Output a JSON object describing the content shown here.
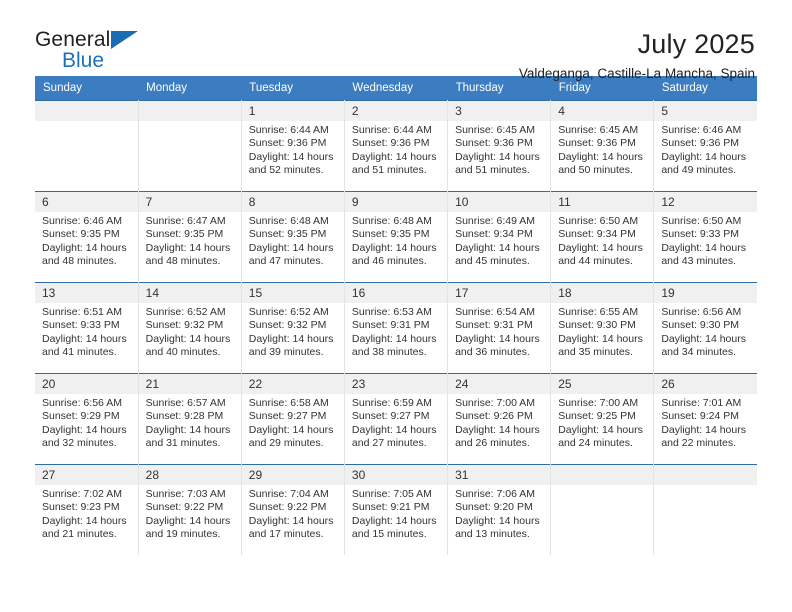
{
  "brand": {
    "line1": "General",
    "line2": "Blue",
    "triangle_color": "#1b6cb3"
  },
  "header": {
    "month_title": "July 2025",
    "location": "Valdeganga, Castille-La Mancha, Spain"
  },
  "colors": {
    "header_row_bg": "#3b7dc0",
    "week_separator": "#2e6ca8",
    "daynum_bg": "#f0f0f0",
    "accent_blue": "#1d72b8"
  },
  "weekday_headers": [
    "Sunday",
    "Monday",
    "Tuesday",
    "Wednesday",
    "Thursday",
    "Friday",
    "Saturday"
  ],
  "weeks": [
    [
      {
        "day": "",
        "lines": []
      },
      {
        "day": "",
        "lines": []
      },
      {
        "day": "1",
        "lines": [
          "Sunrise: 6:44 AM",
          "Sunset: 9:36 PM",
          "Daylight: 14 hours",
          "and 52 minutes."
        ]
      },
      {
        "day": "2",
        "lines": [
          "Sunrise: 6:44 AM",
          "Sunset: 9:36 PM",
          "Daylight: 14 hours",
          "and 51 minutes."
        ]
      },
      {
        "day": "3",
        "lines": [
          "Sunrise: 6:45 AM",
          "Sunset: 9:36 PM",
          "Daylight: 14 hours",
          "and 51 minutes."
        ]
      },
      {
        "day": "4",
        "lines": [
          "Sunrise: 6:45 AM",
          "Sunset: 9:36 PM",
          "Daylight: 14 hours",
          "and 50 minutes."
        ]
      },
      {
        "day": "5",
        "lines": [
          "Sunrise: 6:46 AM",
          "Sunset: 9:36 PM",
          "Daylight: 14 hours",
          "and 49 minutes."
        ]
      }
    ],
    [
      {
        "day": "6",
        "lines": [
          "Sunrise: 6:46 AM",
          "Sunset: 9:35 PM",
          "Daylight: 14 hours",
          "and 48 minutes."
        ]
      },
      {
        "day": "7",
        "lines": [
          "Sunrise: 6:47 AM",
          "Sunset: 9:35 PM",
          "Daylight: 14 hours",
          "and 48 minutes."
        ]
      },
      {
        "day": "8",
        "lines": [
          "Sunrise: 6:48 AM",
          "Sunset: 9:35 PM",
          "Daylight: 14 hours",
          "and 47 minutes."
        ]
      },
      {
        "day": "9",
        "lines": [
          "Sunrise: 6:48 AM",
          "Sunset: 9:35 PM",
          "Daylight: 14 hours",
          "and 46 minutes."
        ]
      },
      {
        "day": "10",
        "lines": [
          "Sunrise: 6:49 AM",
          "Sunset: 9:34 PM",
          "Daylight: 14 hours",
          "and 45 minutes."
        ]
      },
      {
        "day": "11",
        "lines": [
          "Sunrise: 6:50 AM",
          "Sunset: 9:34 PM",
          "Daylight: 14 hours",
          "and 44 minutes."
        ]
      },
      {
        "day": "12",
        "lines": [
          "Sunrise: 6:50 AM",
          "Sunset: 9:33 PM",
          "Daylight: 14 hours",
          "and 43 minutes."
        ]
      }
    ],
    [
      {
        "day": "13",
        "lines": [
          "Sunrise: 6:51 AM",
          "Sunset: 9:33 PM",
          "Daylight: 14 hours",
          "and 41 minutes."
        ]
      },
      {
        "day": "14",
        "lines": [
          "Sunrise: 6:52 AM",
          "Sunset: 9:32 PM",
          "Daylight: 14 hours",
          "and 40 minutes."
        ]
      },
      {
        "day": "15",
        "lines": [
          "Sunrise: 6:52 AM",
          "Sunset: 9:32 PM",
          "Daylight: 14 hours",
          "and 39 minutes."
        ]
      },
      {
        "day": "16",
        "lines": [
          "Sunrise: 6:53 AM",
          "Sunset: 9:31 PM",
          "Daylight: 14 hours",
          "and 38 minutes."
        ]
      },
      {
        "day": "17",
        "lines": [
          "Sunrise: 6:54 AM",
          "Sunset: 9:31 PM",
          "Daylight: 14 hours",
          "and 36 minutes."
        ]
      },
      {
        "day": "18",
        "lines": [
          "Sunrise: 6:55 AM",
          "Sunset: 9:30 PM",
          "Daylight: 14 hours",
          "and 35 minutes."
        ]
      },
      {
        "day": "19",
        "lines": [
          "Sunrise: 6:56 AM",
          "Sunset: 9:30 PM",
          "Daylight: 14 hours",
          "and 34 minutes."
        ]
      }
    ],
    [
      {
        "day": "20",
        "lines": [
          "Sunrise: 6:56 AM",
          "Sunset: 9:29 PM",
          "Daylight: 14 hours",
          "and 32 minutes."
        ]
      },
      {
        "day": "21",
        "lines": [
          "Sunrise: 6:57 AM",
          "Sunset: 9:28 PM",
          "Daylight: 14 hours",
          "and 31 minutes."
        ]
      },
      {
        "day": "22",
        "lines": [
          "Sunrise: 6:58 AM",
          "Sunset: 9:27 PM",
          "Daylight: 14 hours",
          "and 29 minutes."
        ]
      },
      {
        "day": "23",
        "lines": [
          "Sunrise: 6:59 AM",
          "Sunset: 9:27 PM",
          "Daylight: 14 hours",
          "and 27 minutes."
        ]
      },
      {
        "day": "24",
        "lines": [
          "Sunrise: 7:00 AM",
          "Sunset: 9:26 PM",
          "Daylight: 14 hours",
          "and 26 minutes."
        ]
      },
      {
        "day": "25",
        "lines": [
          "Sunrise: 7:00 AM",
          "Sunset: 9:25 PM",
          "Daylight: 14 hours",
          "and 24 minutes."
        ]
      },
      {
        "day": "26",
        "lines": [
          "Sunrise: 7:01 AM",
          "Sunset: 9:24 PM",
          "Daylight: 14 hours",
          "and 22 minutes."
        ]
      }
    ],
    [
      {
        "day": "27",
        "lines": [
          "Sunrise: 7:02 AM",
          "Sunset: 9:23 PM",
          "Daylight: 14 hours",
          "and 21 minutes."
        ]
      },
      {
        "day": "28",
        "lines": [
          "Sunrise: 7:03 AM",
          "Sunset: 9:22 PM",
          "Daylight: 14 hours",
          "and 19 minutes."
        ]
      },
      {
        "day": "29",
        "lines": [
          "Sunrise: 7:04 AM",
          "Sunset: 9:22 PM",
          "Daylight: 14 hours",
          "and 17 minutes."
        ]
      },
      {
        "day": "30",
        "lines": [
          "Sunrise: 7:05 AM",
          "Sunset: 9:21 PM",
          "Daylight: 14 hours",
          "and 15 minutes."
        ]
      },
      {
        "day": "31",
        "lines": [
          "Sunrise: 7:06 AM",
          "Sunset: 9:20 PM",
          "Daylight: 14 hours",
          "and 13 minutes."
        ]
      },
      {
        "day": "",
        "lines": []
      },
      {
        "day": "",
        "lines": []
      }
    ]
  ]
}
